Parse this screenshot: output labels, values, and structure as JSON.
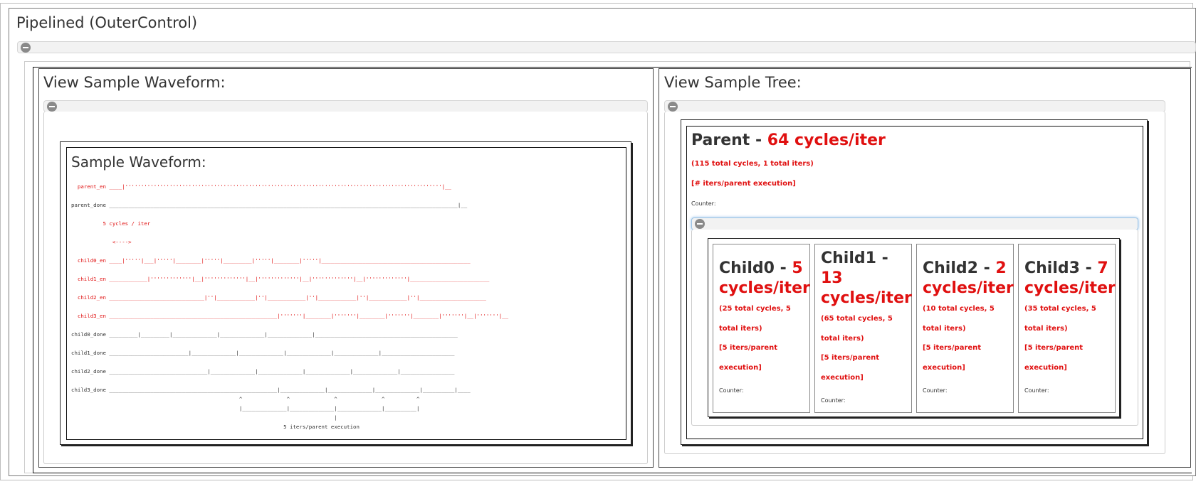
{
  "main": {
    "title": "Pipelined (OuterControl)"
  },
  "waveform_panel": {
    "title": "View Sample Waveform:",
    "inner_title": "Sample Waveform:",
    "signals": [
      "parent_en",
      "parent_done",
      "child0_en",
      "child1_en",
      "child2_en",
      "child3_en",
      "child0_done",
      "child1_done",
      "child2_done",
      "child3_done"
    ],
    "annotation_cycles": "5 cycles / iter",
    "annotation_arrow": "<---->",
    "annotation_iters": "5 iters/parent execution"
  },
  "tree_panel": {
    "title": "View Sample Tree:",
    "parent": {
      "name": "Parent - ",
      "rate": "64 cycles/iter",
      "totals": "(115 total cycles, 1 total iters)",
      "iters": "[# iters/parent execution]",
      "counter": "Counter:"
    },
    "children": [
      {
        "name": "Child0 - ",
        "rate": "5 cycles/iter",
        "totals": "(25 total cycles, 5 total iters)",
        "iters": "[5 iters/parent execution]",
        "counter": "Counter:"
      },
      {
        "name": "Child1 - ",
        "rate": "13 cycles/iter",
        "totals": "(65 total cycles, 5 total iters)",
        "iters": "[5 iters/parent execution]",
        "counter": "Counter:"
      },
      {
        "name": "Child2 - ",
        "rate": "2 cycles/iter",
        "totals": "(10 total cycles, 5 total iters)",
        "iters": "[5 iters/parent execution]",
        "counter": "Counter:"
      },
      {
        "name": "Child3 - ",
        "rate": "7 cycles/iter",
        "totals": "(35 total cycles, 5 total iters)",
        "iters": "[5 iters/parent execution]",
        "counter": "Counter:"
      }
    ]
  },
  "colors": {
    "accent_red": "#e01010",
    "text": "#333333",
    "border": "#111111"
  }
}
